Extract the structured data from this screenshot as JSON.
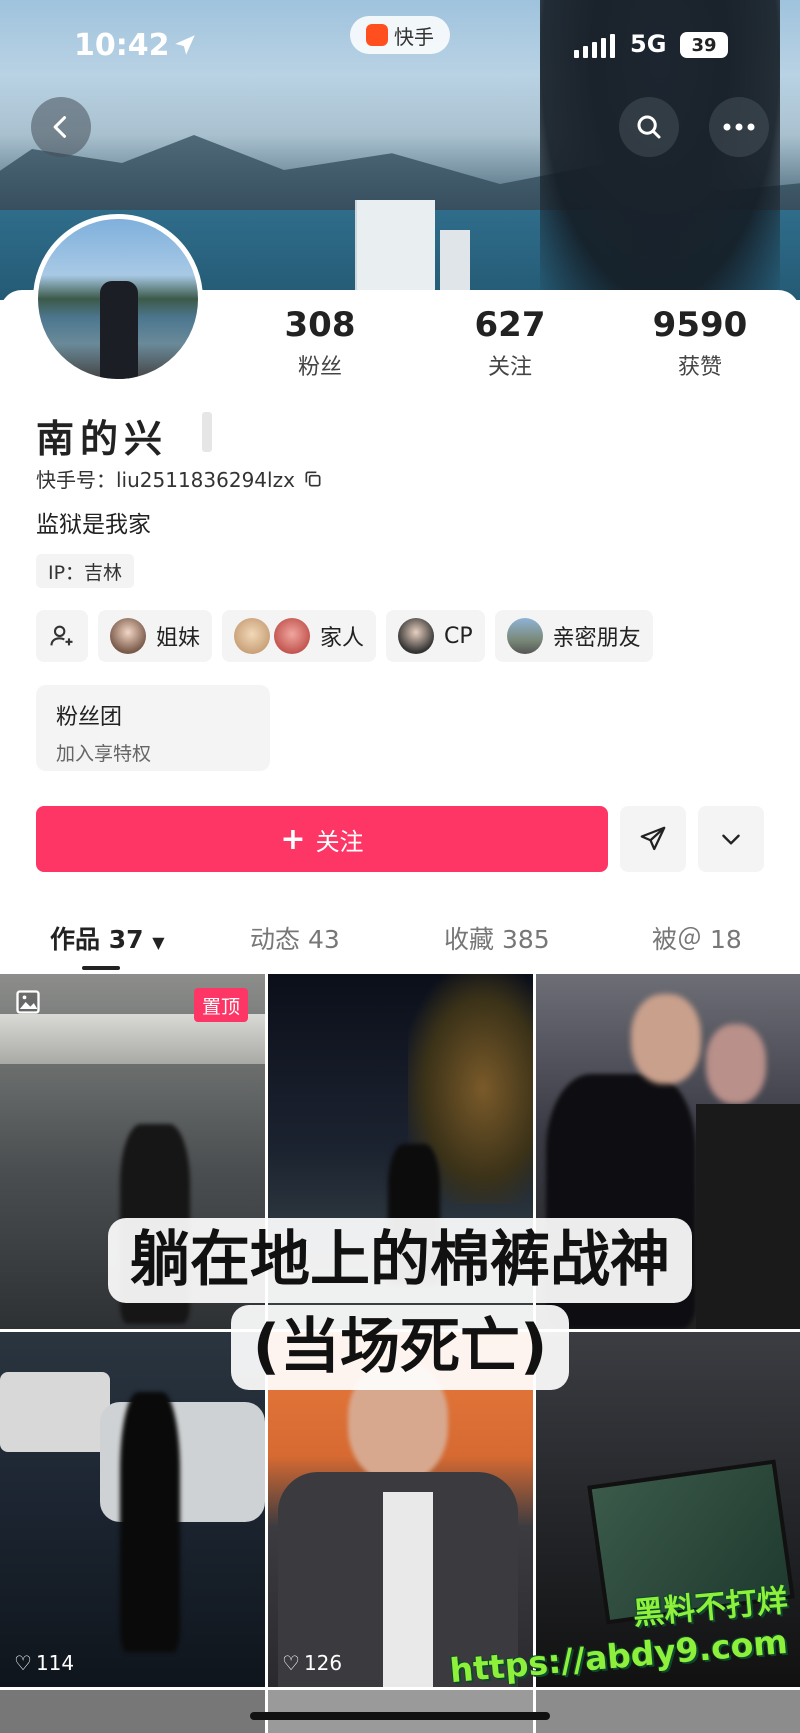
{
  "status_bar": {
    "time": "10:42",
    "network": "5G",
    "battery": "39"
  },
  "app": {
    "name": "快手"
  },
  "profile": {
    "name": "南的兴",
    "kuaishou_id": "快手号：liu2511836294lzx",
    "bio": "监狱是我家",
    "ip": "IP：吉林"
  },
  "stats": [
    {
      "value": "308",
      "label": "粉丝"
    },
    {
      "value": "627",
      "label": "关注"
    },
    {
      "value": "9590",
      "label": "获赞"
    }
  ],
  "relations": [
    {
      "label": "姐妹"
    },
    {
      "label": "家人"
    },
    {
      "label": "CP"
    },
    {
      "label": "亲密朋友"
    }
  ],
  "fan_club": {
    "title": "粉丝团",
    "subtitle": "加入享特权"
  },
  "actions": {
    "follow_label": "关注"
  },
  "tabs": [
    {
      "label": "作品 37"
    },
    {
      "label": "动态 43"
    },
    {
      "label": "收藏 385"
    },
    {
      "label": "被＠ 18"
    }
  ],
  "grid": {
    "pinned_label": "置顶",
    "likes": [
      "114",
      "126"
    ]
  },
  "caption": {
    "line1": "躺在地上的棉裤战神",
    "line2": "(当场死亡)"
  },
  "watermark": {
    "line1": "黑料不打烊",
    "line2": "https://abdy9.com"
  },
  "colors": {
    "accent": "#fe3666",
    "watermark": "#8ef03a"
  }
}
